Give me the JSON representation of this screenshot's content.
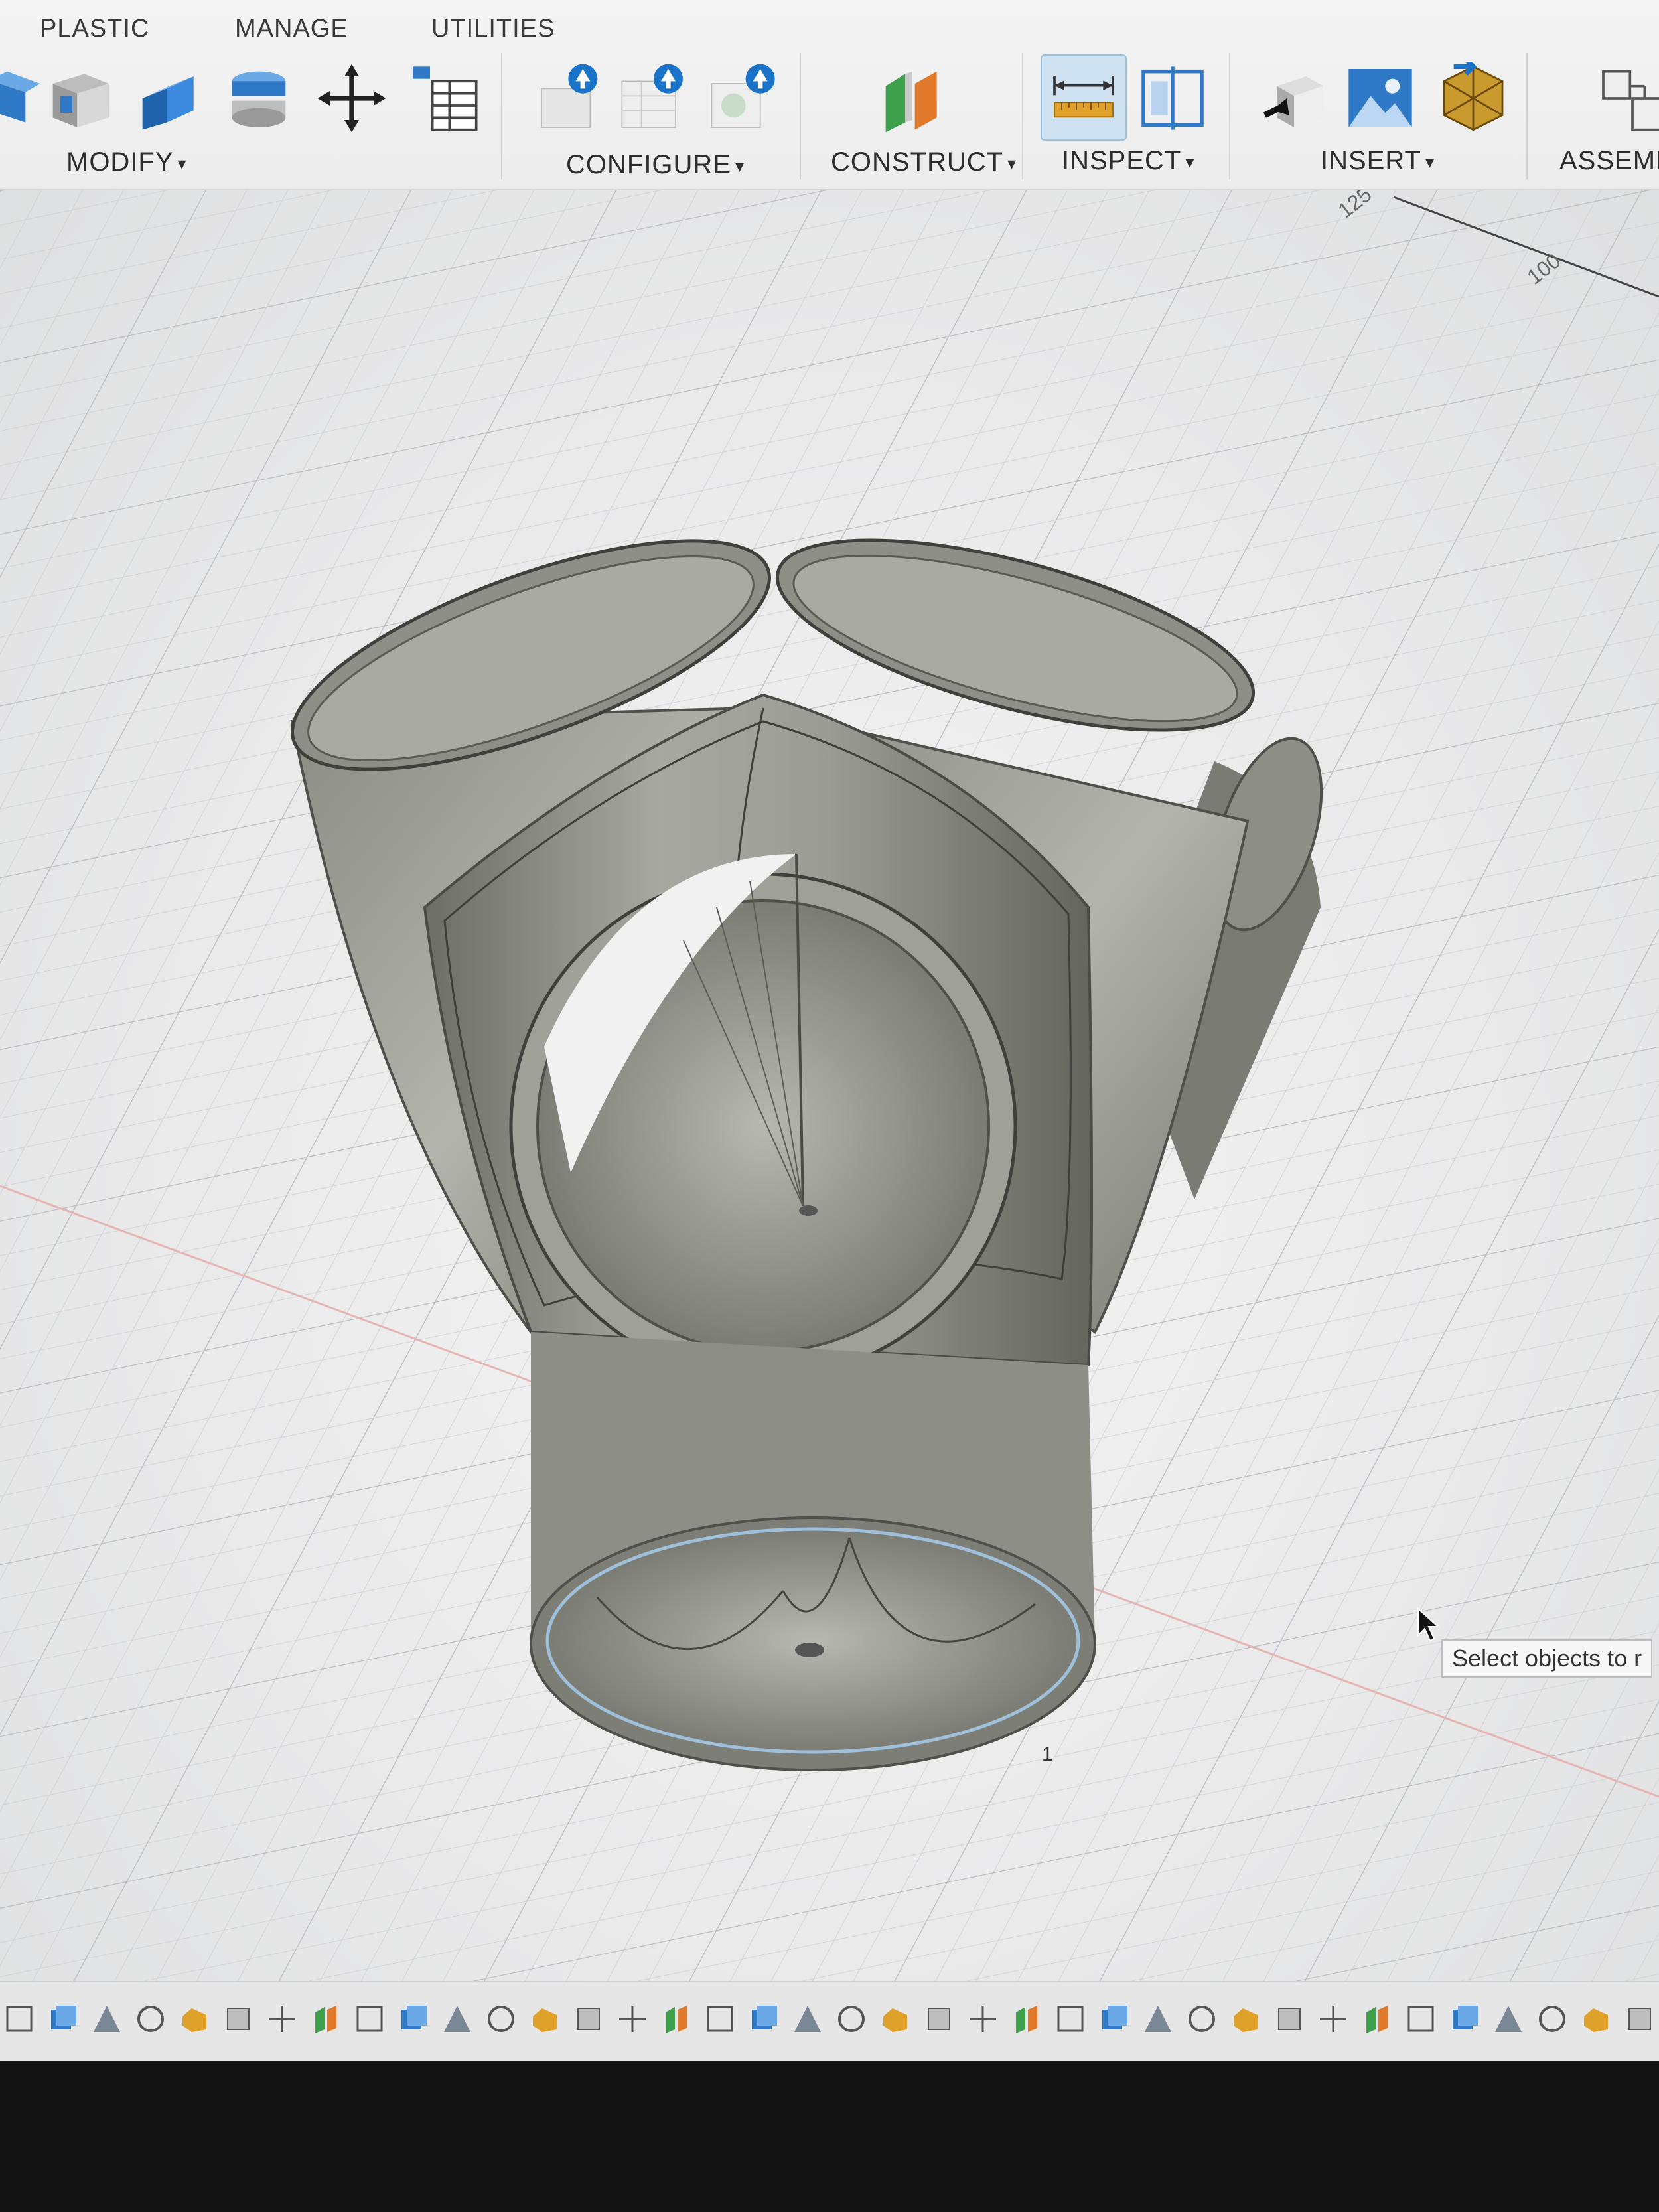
{
  "ribbon": {
    "tabs": [
      "PLASTIC",
      "MANAGE",
      "UTILITIES"
    ],
    "groups": {
      "modify": "MODIFY",
      "configure": "CONFIGURE",
      "construct": "CONSTRUCT",
      "inspect": "INSPECT",
      "insert": "INSERT",
      "assemble": "ASSEMB"
    }
  },
  "viewport": {
    "axis_labels": [
      "125",
      "100"
    ],
    "tooltip": "Select objects to r",
    "point_label": "1"
  },
  "colors": {
    "accent": "#1a73c9",
    "model": "#8e8f86",
    "grid": "#c8c9cb",
    "tooltip_bg": "#f7f7f7"
  },
  "icons": {
    "modify": [
      "press-pull-icon",
      "shell-icon",
      "combine-icon",
      "split-body-icon",
      "move-icon",
      "parameters-icon"
    ],
    "configure": [
      "configure-update-icon",
      "configure-table-icon",
      "configure-rule-icon"
    ],
    "construct": [
      "offset-plane-icon"
    ],
    "inspect": [
      "measure-icon",
      "section-analysis-icon"
    ],
    "insert": [
      "insert-derive-icon",
      "insert-canvas-icon",
      "insert-mesh-icon"
    ],
    "assemble": [
      "new-component-icon"
    ],
    "navigation": [
      "orbit-icon",
      "look-at-icon",
      "pan-icon",
      "zoom-icon",
      "fit-icon",
      "display-settings-icon",
      "grid-snaps-icon",
      "viewports-icon"
    ]
  }
}
